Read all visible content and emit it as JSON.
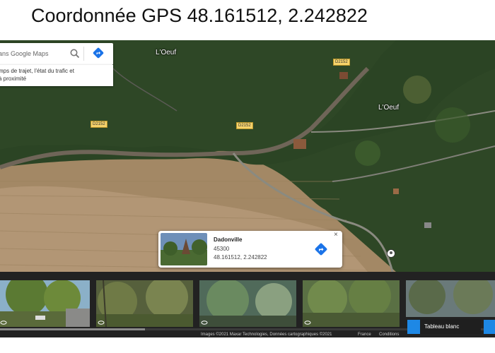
{
  "page_title": "Coordonnée GPS 48.161512, 2.242822",
  "search": {
    "placeholder": "ans Google Maps",
    "hint_lines": [
      "mps de trajet, l'état du trafic et",
      "à proximité"
    ],
    "icon": "search-icon",
    "directions_icon": "directions-icon"
  },
  "map": {
    "place_labels": [
      "L'Oeuf",
      "L'Oeuf"
    ],
    "road_badges": [
      "D2152",
      "D2152",
      "D2152"
    ],
    "pin_icon": "location-pin-icon",
    "colors": {
      "forest": "#2f4a26",
      "field": "#a48a66",
      "road": "#6f6558",
      "badge": "#f6d36b"
    }
  },
  "info_card": {
    "name": "Dadonville",
    "postcode": "45300",
    "coordinates": "48.161512, 2.242822",
    "close_label": "×",
    "directions_icon": "directions-icon"
  },
  "photo_strip": {
    "thumbnail_icon": "rotate-360-icon",
    "attribution": "Images ©2021 Maxar Technologies, Données cartographiques ©2021",
    "region": "France",
    "terms": "Conditions",
    "tableau_button": "Tableau blanc",
    "accent_color": "#1e88e5"
  }
}
